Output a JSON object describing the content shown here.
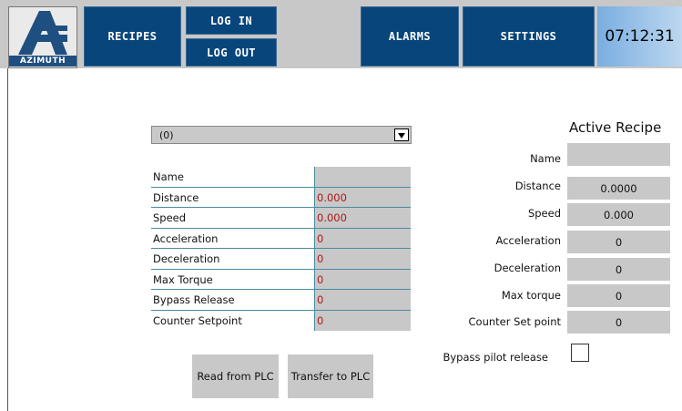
{
  "header": {
    "logo_text": "AZIMUTH",
    "recipes_label": "RECIPES",
    "login_label": "LOG IN",
    "logout_label": "LOG OUT",
    "alarms_label": "ALARMS",
    "settings_label": "SETTINGS",
    "clock": "07:12:31"
  },
  "recipe_selector": {
    "selected": "(0)"
  },
  "parameters": {
    "rows": [
      {
        "label": "Name",
        "value": ""
      },
      {
        "label": "Distance",
        "value": "0.000"
      },
      {
        "label": "Speed",
        "value": "0.000"
      },
      {
        "label": "Acceleration",
        "value": "0"
      },
      {
        "label": "Deceleration",
        "value": "0"
      },
      {
        "label": "Max Torque",
        "value": "0"
      },
      {
        "label": "Bypass Release",
        "value": "0"
      },
      {
        "label": "Counter Setpoint",
        "value": "0"
      }
    ]
  },
  "buttons": {
    "read_label": "Read from PLC",
    "transfer_label": "Transfer to PLC"
  },
  "active_recipe": {
    "title": "Active Recipe",
    "rows": [
      {
        "label": "Name",
        "value": ""
      },
      {
        "label": "Distance",
        "value": "0.0000"
      },
      {
        "label": "Speed",
        "value": "0.000"
      },
      {
        "label": "Acceleration",
        "value": "0"
      },
      {
        "label": "Deceleration",
        "value": "0"
      },
      {
        "label": "Max torque",
        "value": "0"
      },
      {
        "label": "Counter Set point",
        "value": "0"
      }
    ],
    "bypass_label": "Bypass pilot release"
  },
  "colors": {
    "nav": "#07457a",
    "accent_value": "#b01616",
    "panel": "#c8c8c8"
  }
}
